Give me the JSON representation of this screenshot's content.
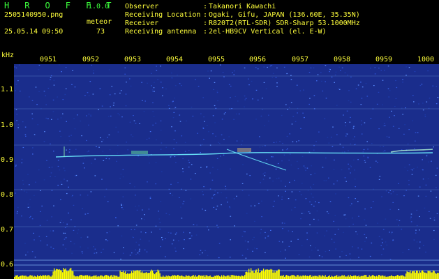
{
  "header": {
    "app_title": "H R O F F T",
    "app_version": "1.0.0",
    "file_name": "2505140950.png",
    "timestamp": "25.05.14 09:50",
    "mode_label": "meteor",
    "count_value": "73"
  },
  "info": [
    {
      "label": "Observer",
      "colon": ":",
      "value": "Takanori Kawachi"
    },
    {
      "label": "Receiving Location",
      "colon": ":",
      "value": "Ogaki, Gifu, JAPAN (136.60E, 35.35N)"
    },
    {
      "label": "Receiver",
      "colon": ":",
      "value": "R820T2(RTL-SDR) SDR-Sharp 53.1000MHz"
    },
    {
      "label": "Receiving antenna",
      "colon": ":",
      "value": "2el-HB9CV Vertical (el. E-W)"
    }
  ],
  "axes": {
    "freq_unit": "kHz",
    "time_ticks": [
      "0951",
      "0952",
      "0953",
      "0954",
      "0955",
      "0956",
      "0957",
      "0958",
      "0959",
      "1000"
    ],
    "freq_ticks": [
      "1.1",
      "1.0",
      "0.9",
      "0.8",
      "0.7",
      "0.6"
    ]
  },
  "colors": {
    "label_green": "#3cff3c",
    "label_yellow": "#ffff3c",
    "background_blue": "#1a2d8c",
    "signal_cyan": "#6ef0ff",
    "carrier_line": "#8fc4ff",
    "level_yellow": "#ffff00"
  }
}
